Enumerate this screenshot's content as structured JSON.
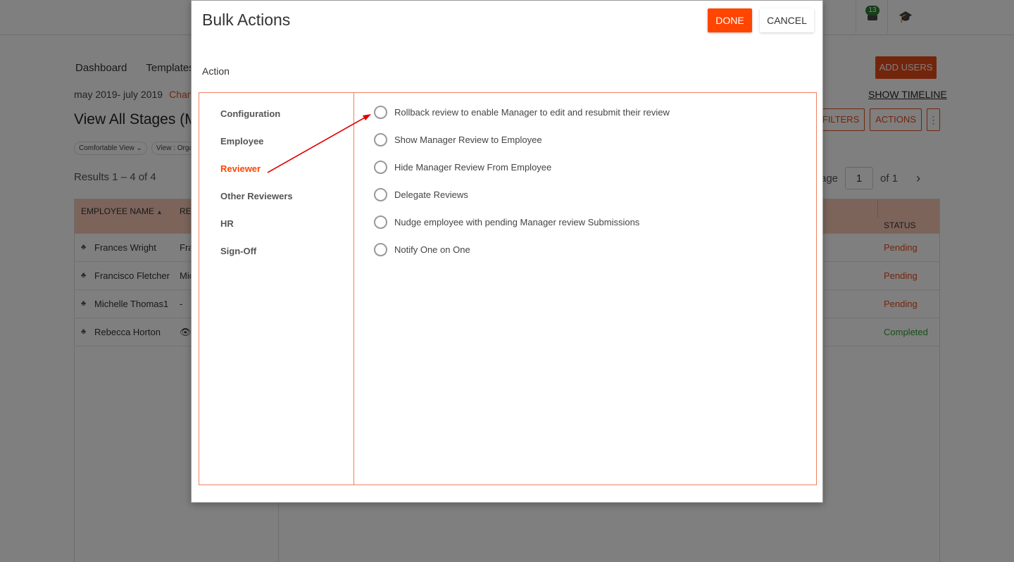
{
  "background": {
    "notifications_count": "13",
    "nav": [
      "Dashboard",
      "Templates"
    ],
    "add_users_label": "ADD USERS",
    "period_text": "may 2019- july 2019",
    "change_link": "Chang",
    "show_timeline_label": "SHOW TIMELINE",
    "view_title": "View All Stages (May",
    "filters_label": "FILTERS",
    "actions_label": "ACTIONS",
    "more_label": "⋮",
    "chips": [
      "Comfortable View",
      "View : Organ"
    ],
    "results_text": "Results 1 – 4 of 4",
    "pager": {
      "page_label": "age",
      "page_value": "1",
      "of_label": "of 1"
    },
    "table": {
      "headers": {
        "employee": "EMPLOYEE NAME",
        "reviewer": "RE",
        "status": "STATUS"
      },
      "rows": [
        {
          "name": "Frances Wright",
          "reviewer": "Fra",
          "status": "Pending"
        },
        {
          "name": "Francisco Fletcher",
          "reviewer": "Mic",
          "status": "Pending"
        },
        {
          "name": "Michelle Thomas1",
          "reviewer": "-",
          "status": "Pending"
        },
        {
          "name": "Rebecca Horton",
          "reviewer": "👁",
          "status": "Completed"
        }
      ]
    },
    "colors": {
      "pending": "#e64a19",
      "completed": "#2e9e2e",
      "accent": "#e64a19"
    }
  },
  "modal": {
    "title": "Bulk Actions",
    "done_label": "DONE",
    "cancel_label": "CANCEL",
    "action_label": "Action",
    "categories": [
      "Configuration",
      "Employee",
      "Reviewer",
      "Other Reviewers",
      "HR",
      "Sign-Off"
    ],
    "active_category": "Reviewer",
    "options": [
      "Rollback review to enable Manager to edit and resubmit their review",
      "Show Manager Review to Employee",
      "Hide Manager Review From Employee",
      "Delegate Reviews",
      "Nudge employee with pending Manager review Submissions",
      "Notify One on One"
    ],
    "colors": {
      "done": "#ff4500",
      "active_category": "#ff4500",
      "panel_border": "#f08060",
      "annotation_arrow": "#e00000"
    }
  }
}
